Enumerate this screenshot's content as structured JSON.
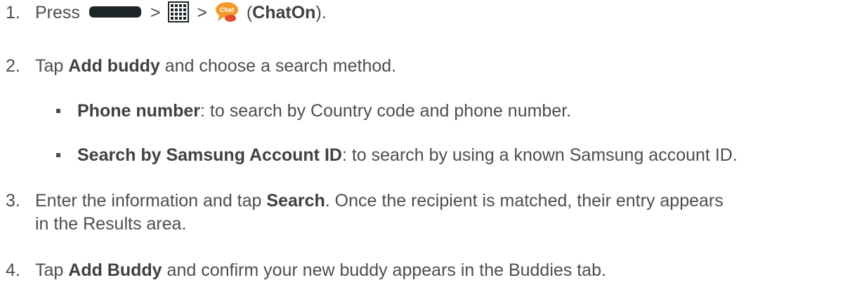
{
  "steps": [
    {
      "number": "1.",
      "prefix": "Press",
      "sep1": ">",
      "sep2": ">",
      "paren_open": "(",
      "app_name": "ChatOn",
      "paren_close": ")."
    },
    {
      "number": "2.",
      "before": "Tap",
      "bold": "Add buddy",
      "after": "and choose a search method."
    },
    {
      "number": "3.",
      "before": "Enter the information and tap",
      "bold": "Search",
      "after": ". Once the recipient is matched, their entry appears",
      "line2": "in the Results area."
    },
    {
      "number": "4.",
      "before": "Tap",
      "bold": "Add Buddy",
      "after": "and confirm your new buddy appears in the Buddies tab."
    }
  ],
  "bullets": [
    {
      "bold": "Phone number",
      "after": ": to search by Country code and phone number."
    },
    {
      "bold": "Search by Samsung Account ID",
      "after": ": to search by using a known Samsung account ID."
    }
  ],
  "icons": {
    "home_key": "home-key-icon",
    "apps": "apps-grid-icon",
    "chaton": "chaton-app-icon",
    "chaton_label": "Chat"
  },
  "colors": {
    "text": "#4d4d4d",
    "home_key": "#1e2529",
    "chaton_orange": "#f39a2a"
  }
}
